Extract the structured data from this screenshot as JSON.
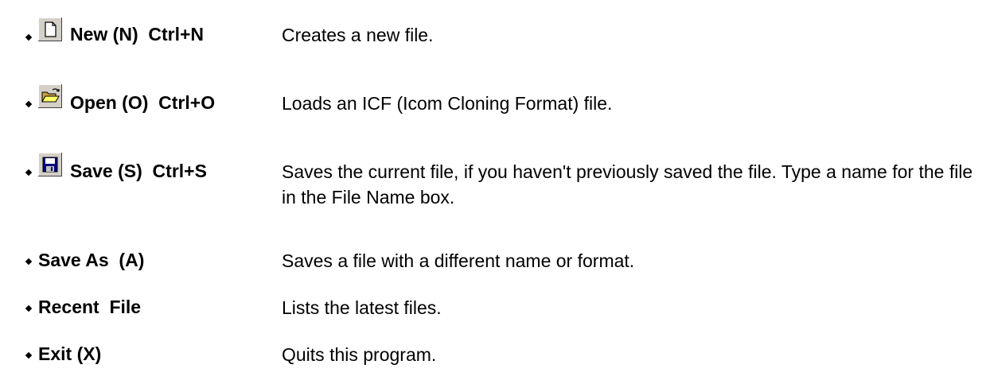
{
  "menu_items": [
    {
      "term": "New (N)  Ctrl+N",
      "description": "Creates a new file.",
      "icon": "new-file-icon"
    },
    {
      "term": "Open (O)  Ctrl+O",
      "description": "Loads an ICF (Icom Cloning Format) file.",
      "icon": "open-folder-icon"
    },
    {
      "term": "Save (S)  Ctrl+S",
      "description": "Saves the current file, if you haven't previously saved the file. Type a name for the file in the File Name box.",
      "icon": "floppy-disk-icon"
    },
    {
      "term": "Save As  (A)",
      "description": "Saves a file with a different name or format."
    },
    {
      "term": "Recent  File",
      "description": "Lists the latest files."
    },
    {
      "term": "Exit (X)",
      "description": "Quits this program."
    }
  ]
}
